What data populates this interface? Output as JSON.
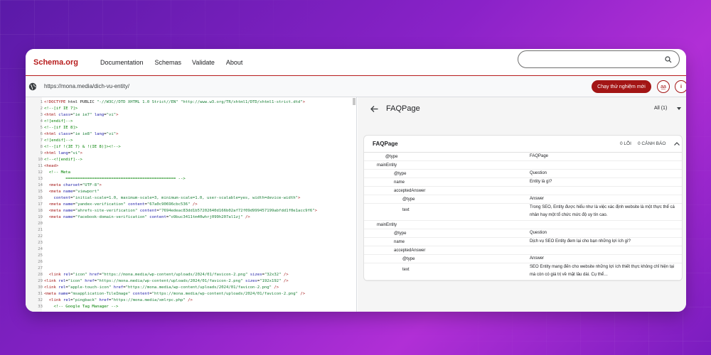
{
  "nav": {
    "logo": "Schema.org",
    "items": [
      "Documentation",
      "Schemas",
      "Validate",
      "About"
    ],
    "search_placeholder": ""
  },
  "urlbar": {
    "url": "https://mona.media/dich-vu-entity/",
    "run_button": "Chạy thử nghiệm mới",
    "lang_button": "a͟a",
    "info_button": "i"
  },
  "code": [
    {
      "n": "1",
      "t": "<!DOCTYPE html PUBLIC \"-//W3C//DTD XHTML 1.0 Strict//EN\" \"http://www.w3.org/TR/xhtml1/DTD/xhtml1-strict.dtd\">"
    },
    {
      "n": "2",
      "t": "<!--[if IE 7]>"
    },
    {
      "n": "3",
      "t": "<html class=\"ie ie7\" lang=\"vi\">"
    },
    {
      "n": "4",
      "t": "<![endif]-->"
    },
    {
      "n": "5",
      "t": "<!--[if IE 8]>"
    },
    {
      "n": "6",
      "t": "<html class=\"ie ie8\" lang=\"vi\">"
    },
    {
      "n": "7",
      "t": "<![endif]-->"
    },
    {
      "n": "8",
      "t": "<!--[if !(IE 7) & !(IE 8)]><!-->"
    },
    {
      "n": "9",
      "t": "<html lang=\"vi\">"
    },
    {
      "n": "10",
      "t": "<!--<![endif]-->"
    },
    {
      "n": "11",
      "t": "<head>"
    },
    {
      "n": "12",
      "t": "  <!-- Meta"
    },
    {
      "n": "13",
      "t": "         ============================================== -->"
    },
    {
      "n": "14",
      "t": "  <meta charset=\"UTF-8\">"
    },
    {
      "n": "15",
      "t": "  <meta name=\"viewport\""
    },
    {
      "n": "16",
      "t": "    content=\"initial-scale=1.0, maximum-scale=3, minimum-scale=1.0, user-scalable=yes, width=device-width\">"
    },
    {
      "n": "17",
      "t": "  <meta name=\"yandex-verification\" content=\"67a0c90696cbc536\" />"
    },
    {
      "n": "18",
      "t": "  <meta name=\"ahrefs-site-verification\" content=\"7694edeac83dd1b57202640d166b02af72f09d999457199abfdd1f0e1acc9f6\">"
    },
    {
      "n": "19",
      "t": "  <meta name=\"facebook-domain-verification\" content=\"o9buc3411tm40whrj099h207al1zj\" />"
    },
    {
      "n": "20",
      "t": ""
    },
    {
      "n": "21",
      "t": ""
    },
    {
      "n": "22",
      "t": ""
    },
    {
      "n": "23",
      "t": ""
    },
    {
      "n": "24",
      "t": ""
    },
    {
      "n": "25",
      "t": ""
    },
    {
      "n": "26",
      "t": ""
    },
    {
      "n": "27",
      "t": ""
    },
    {
      "n": "28",
      "t": "  <link rel=\"icon\" href=\"https://mona.media/wp-content/uploads/2024/01/favicon-2.png\" sizes=\"32x32\" />"
    },
    {
      "n": "29",
      "t": "<link rel=\"icon\" href=\"https://mona.media/wp-content/uploads/2024/01/favicon-2.png\" sizes=\"192x192\" />"
    },
    {
      "n": "30",
      "t": "<link rel=\"apple-touch-icon\" href=\"https://mona.media/wp-content/uploads/2024/01/favicon-2.png\" />"
    },
    {
      "n": "31",
      "t": "<meta name=\"msapplication-TileImage\" content=\"https://mona.media/wp-content/uploads/2024/01/favicon-2.png\" />"
    },
    {
      "n": "32",
      "t": "  <link rel=\"pingback\" href=\"https://mona.media/xmlrpc.php\" />"
    },
    {
      "n": "33",
      "t": "    <!-- Google Tag Manager -->"
    }
  ],
  "result": {
    "title": "FAQPage",
    "filter": "All (1)",
    "card": {
      "title": "FAQPage",
      "errors": "0 LỖI",
      "warnings": "0 CẢNH BÁO",
      "rows": [
        {
          "k": "@type",
          "v": "FAQPage",
          "indent": 1
        },
        {
          "k": "mainEntity",
          "v": "",
          "indent": 0
        },
        {
          "k": "@type",
          "v": "Question",
          "indent": 2
        },
        {
          "k": "name",
          "v": "Entity là gì?",
          "indent": 2
        },
        {
          "k": "acceptedAnswer",
          "v": "",
          "indent": 2
        },
        {
          "k": "@type",
          "v": "Answer",
          "indent": 3
        },
        {
          "k": "text",
          "v": "Trong SEO, Entity được hiểu như là việc xác định website là một thực thể cá nhân hay một tổ chức mức độ uy tín cao.",
          "indent": 3
        },
        {
          "k": "mainEntity",
          "v": "",
          "indent": 0
        },
        {
          "k": "@type",
          "v": "Question",
          "indent": 2
        },
        {
          "k": "name",
          "v": "Dịch vụ SEO Entity đem lại cho bạn những lợi ích gì?",
          "indent": 2
        },
        {
          "k": "acceptedAnswer",
          "v": "",
          "indent": 2
        },
        {
          "k": "@type",
          "v": "Answer",
          "indent": 3
        },
        {
          "k": "text",
          "v": "SEO Entity mang đến cho website những lợi ích thiết thực không chỉ hiện tại mà còn có giá trị về mặt lâu dài. Cụ thể…",
          "indent": 3
        }
      ]
    }
  },
  "colors": {
    "brand": "#b71c1c",
    "button": "#a31515",
    "tag": "#a31515",
    "attr": "#1a1aa6",
    "string": "#1a7f37",
    "comment": "#008000"
  },
  "icons": [
    "search-icon",
    "globe-icon",
    "back-arrow-icon",
    "chevron-down-icon",
    "chevron-up-icon",
    "info-icon"
  ]
}
